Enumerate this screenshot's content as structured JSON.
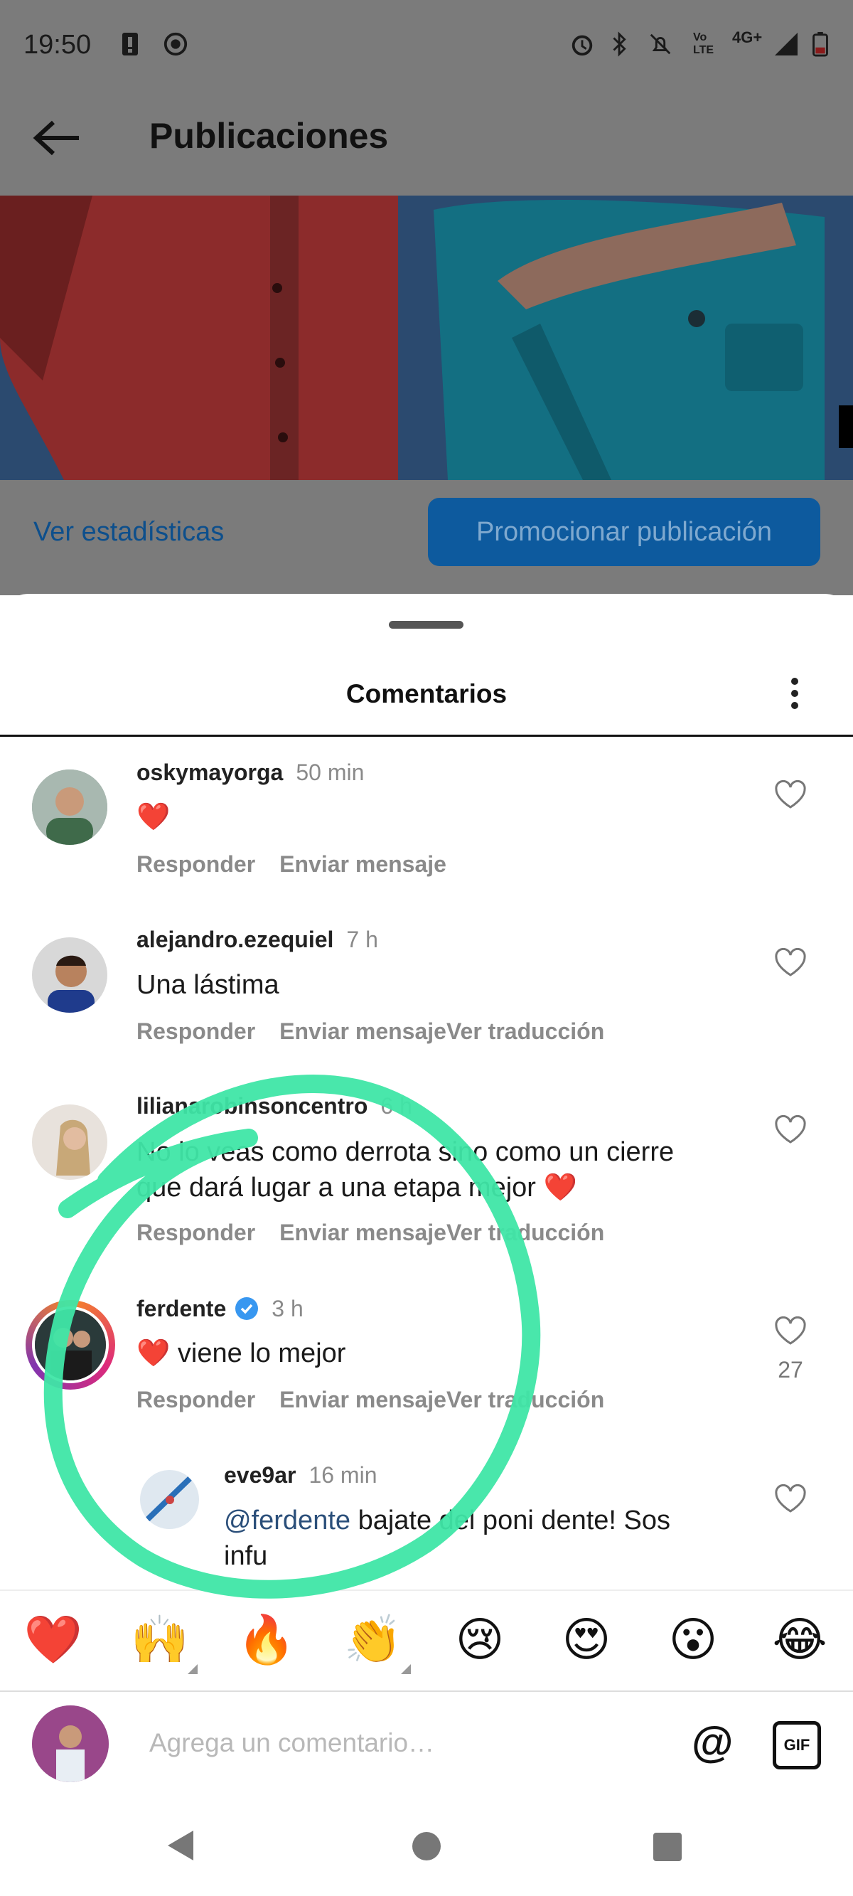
{
  "status_bar": {
    "time": "19:50",
    "network": "4G+",
    "volte": "Vo LTE"
  },
  "header": {
    "title": "Publicaciones"
  },
  "post_actions": {
    "stats_link": "Ver estadísticas",
    "promote_button": "Promocionar publicación"
  },
  "sheet": {
    "title": "Comentarios"
  },
  "comments": [
    {
      "username": "oskymayorga",
      "time": "50 min",
      "text": "❤️",
      "reply": "Responder",
      "message": "Enviar mensaje",
      "translate": ""
    },
    {
      "username": "alejandro.ezequiel",
      "time": "7 h",
      "text": "Una lástima",
      "reply": "Responder",
      "message": "Enviar mensaje",
      "translate": "Ver traducción"
    },
    {
      "username": "lilianarobinsoncentro",
      "time": "6 h",
      "text_line1": "No lo veas como derrota sino como un cierre",
      "text_line2": "que dará lugar a una etapa mejor ❤️",
      "reply": "Responder",
      "message": "Enviar mensaje",
      "translate": "Ver traducción"
    },
    {
      "username": "ferdente",
      "time": "3 h",
      "text": "❤️ viene lo mejor",
      "likes": "27",
      "reply": "Responder",
      "message": "Enviar mensaje",
      "translate": "Ver traducción"
    },
    {
      "username": "eve9ar",
      "time": "16 min",
      "mention": "@ferdente",
      "text_line1": " bajate del poni dente! Sos",
      "text_line2": "infu"
    }
  ],
  "emoji_bar": [
    "❤️",
    "🙌",
    "🔥",
    "👏",
    "😢",
    "😍",
    "😮",
    "😂"
  ],
  "composer": {
    "placeholder": "Agrega un comentario…",
    "at_label": "@",
    "gif_label": "GIF"
  },
  "colors": {
    "accent_blue": "#0095f6",
    "verified": "#3897f0",
    "annotation_green": "#3fe6a6"
  }
}
